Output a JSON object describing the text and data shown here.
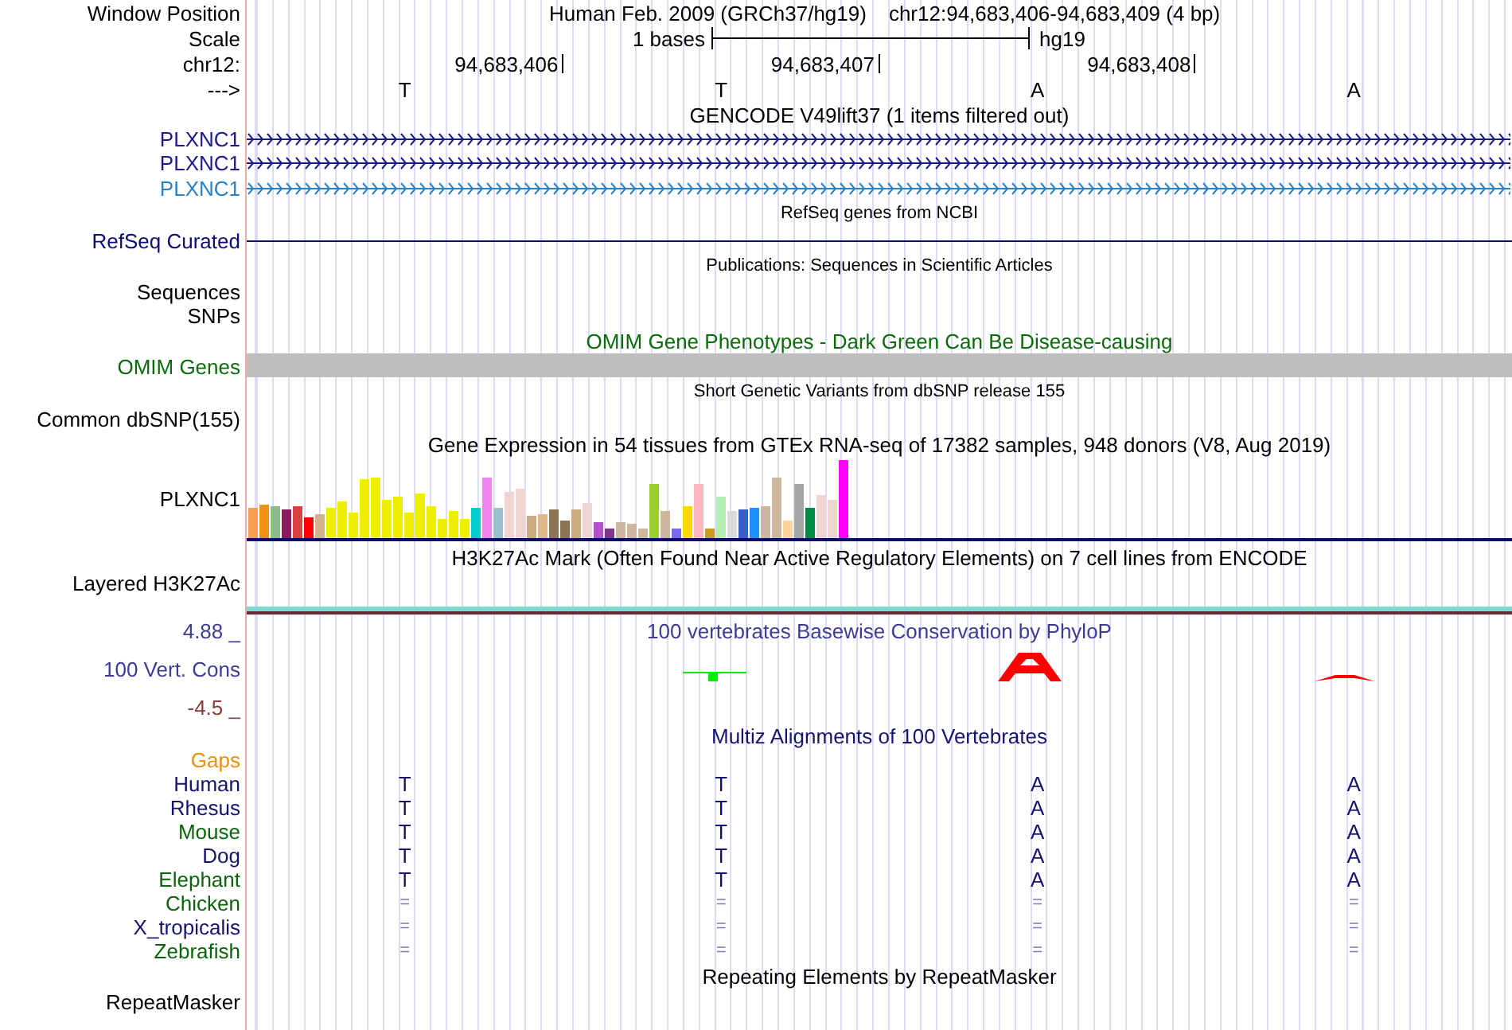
{
  "header": {
    "position_label": "Window Position",
    "assembly_text": "Human Feb. 2009 (GRCh37/hg19)",
    "range_text": "chr12:94,683,406-94,683,409 (4 bp)",
    "scale_label": "Scale",
    "scale_text": "1 bases",
    "scale_assembly": "hg19",
    "chrom_label": "chr12:",
    "ticks": [
      "94,683,406",
      "94,683,407",
      "94,683,408"
    ],
    "strand_label": "--->",
    "bases": [
      "T",
      "T",
      "A",
      "A"
    ]
  },
  "tracks": [
    {
      "kind": "gene",
      "title": {
        "text": "GENCODE V49lift37 (1 items filtered out)",
        "color": "#000000",
        "small": false
      },
      "labels": [
        {
          "text": "PLXNC1",
          "color": "#1a1a8c"
        },
        {
          "text": "PLXNC1",
          "color": "#1a1a8c"
        },
        {
          "text": "PLXNC1",
          "color": "#2a80c4"
        }
      ]
    },
    {
      "kind": "line",
      "title": {
        "text": "RefSeq genes from NCBI",
        "color": "#000000",
        "small": true
      },
      "labels": [
        {
          "text": "RefSeq Curated",
          "color": "#0c0c78"
        }
      ]
    },
    {
      "kind": "empty",
      "title": {
        "text": "Publications: Sequences in Scientific Articles",
        "color": "#000000",
        "small": true
      },
      "labels": [
        {
          "text": "Sequences",
          "color": "#000000"
        },
        {
          "text": "SNPs",
          "color": "#000000"
        }
      ]
    },
    {
      "kind": "bar",
      "title": {
        "text": "OMIM Gene Phenotypes - Dark Green Can Be Disease-causing",
        "color": "#0b6b0b",
        "small": false
      },
      "labels": [
        {
          "text": "OMIM Genes",
          "color": "#0b6b0b"
        }
      ]
    },
    {
      "kind": "empty",
      "title": {
        "text": "Short Genetic Variants from dbSNP release 155",
        "color": "#000000",
        "small": true
      },
      "labels": [
        {
          "text": "Common dbSNP(155)",
          "color": "#000000"
        }
      ]
    },
    {
      "kind": "expression",
      "title": {
        "text": "Gene Expression in 54 tissues from GTEx RNA-seq of 17382 samples, 948 donors (V8, Aug 2019)",
        "color": "#000000",
        "small": false
      },
      "labels": [
        {
          "text": "PLXNC1",
          "color": "#000000"
        }
      ]
    },
    {
      "kind": "layered",
      "title": {
        "text": "H3K27Ac Mark (Often Found Near Active Regulatory Elements) on 7 cell lines from ENCODE",
        "color": "#000000",
        "small": false
      },
      "labels": [
        {
          "text": "Layered H3K27Ac",
          "color": "#000000"
        }
      ]
    },
    {
      "kind": "phylop",
      "title": {
        "text": "100 vertebrates Basewise Conservation by PhyloP",
        "color": "#3c3c96",
        "small": false
      },
      "labels": [
        {
          "text": "4.88 _",
          "color": "#3c3c96"
        },
        {
          "text": "100 Vert. Cons",
          "color": "#3c3c96"
        },
        {
          "text": "-4.5 _",
          "color": "#8c3a3a"
        }
      ]
    },
    {
      "kind": "multiz",
      "title": {
        "text": "Multiz Alignments of 100 Vertebrates",
        "color": "#14146e",
        "small": false
      },
      "labels": [
        {
          "text": "Gaps",
          "color": "#f0900a",
          "kind": "gaps"
        },
        {
          "text": "Human",
          "color": "#14146e",
          "kind": "aligned",
          "bases": [
            "T",
            "T",
            "A",
            "A"
          ]
        },
        {
          "text": "Rhesus",
          "color": "#14146e",
          "kind": "aligned",
          "bases": [
            "T",
            "T",
            "A",
            "A"
          ]
        },
        {
          "text": "Mouse",
          "color": "#0a640a",
          "kind": "aligned",
          "bases": [
            "T",
            "T",
            "A",
            "A"
          ]
        },
        {
          "text": "Dog",
          "color": "#14146e",
          "kind": "aligned",
          "bases": [
            "T",
            "T",
            "A",
            "A"
          ]
        },
        {
          "text": "Elephant",
          "color": "#0a640a",
          "kind": "aligned",
          "bases": [
            "T",
            "T",
            "A",
            "A"
          ]
        },
        {
          "text": "Chicken",
          "color": "#0a640a",
          "kind": "unaligned",
          "bases": [
            "=",
            "=",
            "=",
            "="
          ]
        },
        {
          "text": "X_tropicalis",
          "color": "#14146e",
          "kind": "unaligned",
          "bases": [
            "=",
            "=",
            "=",
            "="
          ]
        },
        {
          "text": "Zebrafish",
          "color": "#0a640a",
          "kind": "unaligned",
          "bases": [
            "=",
            "=",
            "=",
            "="
          ]
        }
      ]
    },
    {
      "kind": "empty",
      "title": {
        "text": "Repeating Elements by RepeatMasker",
        "color": "#000000",
        "small": false
      },
      "labels": [
        {
          "text": "RepeatMasker",
          "color": "#000000"
        }
      ]
    }
  ]
}
